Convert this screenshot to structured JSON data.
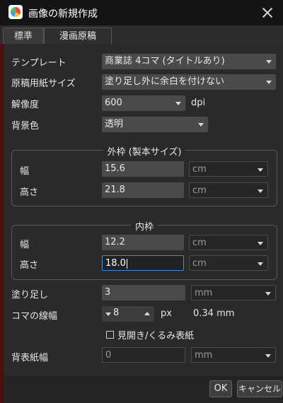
{
  "window": {
    "title": "画像の新規作成",
    "close_label": "×"
  },
  "tabs": [
    {
      "label": "標準"
    },
    {
      "label": "漫画原稿"
    }
  ],
  "form": {
    "template": {
      "label": "テンプレート",
      "value": "商業誌 4コマ (タイトルあり)"
    },
    "paper_size": {
      "label": "原稿用紙サイズ",
      "value": "塗り足し外に余白を付けない"
    },
    "resolution": {
      "label": "解像度",
      "value": "600",
      "unit": "dpi"
    },
    "background": {
      "label": "背景色",
      "value": "透明"
    }
  },
  "outer_frame": {
    "title": "外枠 (製本サイズ)",
    "width": {
      "label": "幅",
      "value": "15.6",
      "unit": "cm"
    },
    "height": {
      "label": "高さ",
      "value": "21.8",
      "unit": "cm"
    }
  },
  "inner_frame": {
    "title": "内枠",
    "width": {
      "label": "幅",
      "value": "12.2",
      "unit": "cm"
    },
    "height": {
      "label": "高さ",
      "value": "18.0",
      "unit": "cm"
    }
  },
  "bleed": {
    "label": "塗り足し",
    "value": "3",
    "unit": "mm"
  },
  "line_width": {
    "label": "コマの線幅",
    "value": "8",
    "unit": "px",
    "converted": "0.34",
    "converted_unit": "mm"
  },
  "spread": {
    "label": "見開き/くるみ表紙",
    "checked": false
  },
  "back_paper": {
    "label": "背表紙幅",
    "value": "0",
    "unit": "mm"
  },
  "buttons": {
    "ok": "OK",
    "cancel": "キャンセル"
  }
}
